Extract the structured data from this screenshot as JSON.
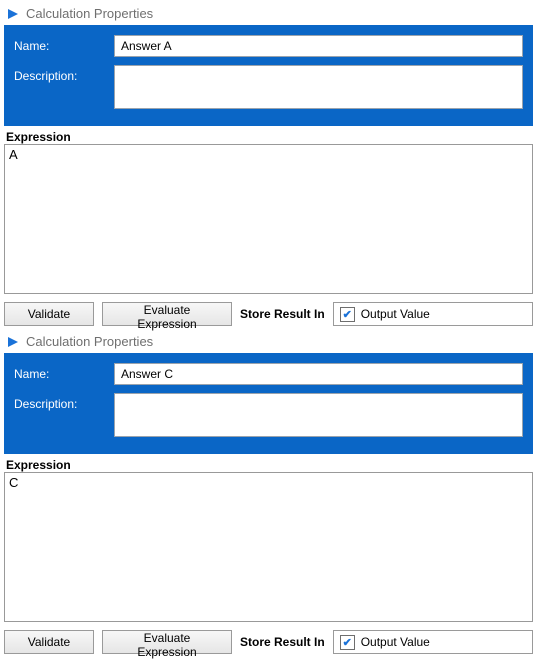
{
  "panels": [
    {
      "title": "Calculation Properties",
      "name_label": "Name:",
      "name_value": "Answer A",
      "desc_label": "Description:",
      "desc_value": "",
      "expr_label": "Expression",
      "expr_value": "A",
      "validate_label": "Validate",
      "evaluate_label": "Evaluate Expression",
      "store_label": "Store Result In",
      "output_value_label": "Output Value"
    },
    {
      "title": "Calculation Properties",
      "name_label": "Name:",
      "name_value": "Answer C",
      "desc_label": "Description:",
      "desc_value": "",
      "expr_label": "Expression",
      "expr_value": "C",
      "validate_label": "Validate",
      "evaluate_label": "Evaluate Expression",
      "store_label": "Store Result In",
      "output_value_label": "Output Value"
    }
  ]
}
